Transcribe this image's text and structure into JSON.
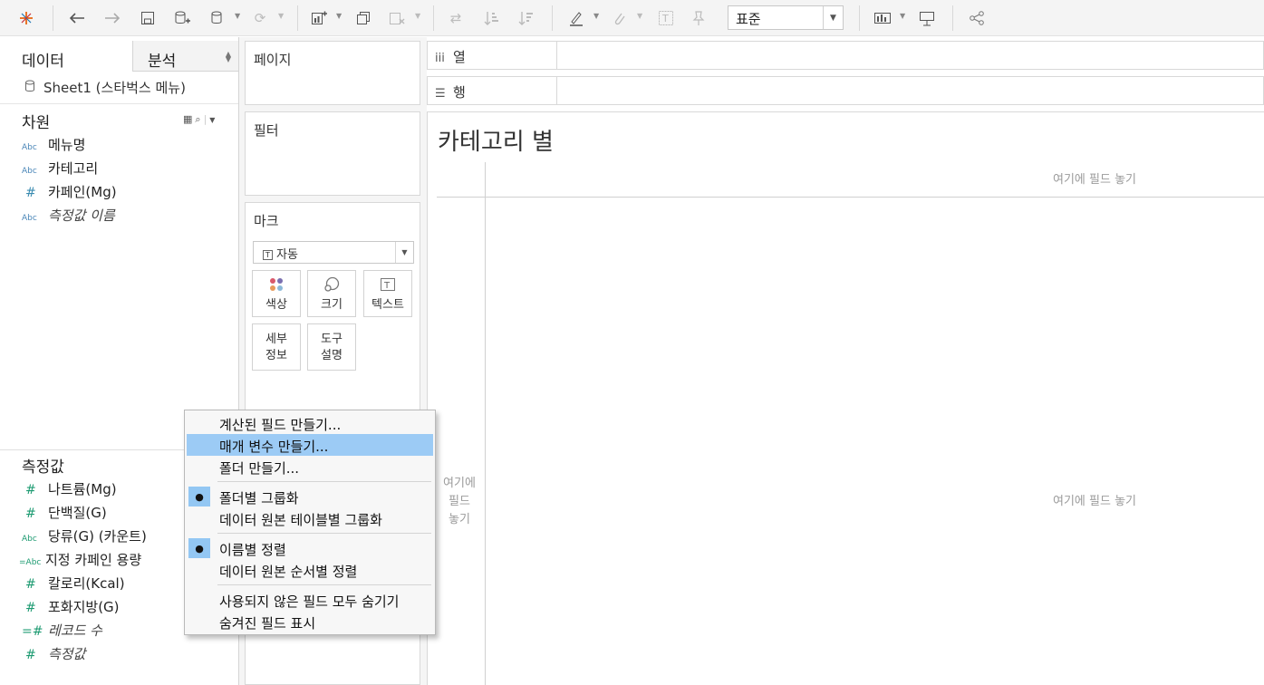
{
  "toolbar": {
    "fit_value": "표준"
  },
  "data_pane": {
    "tabs": [
      {
        "label": "데이터"
      },
      {
        "label": "분석"
      }
    ],
    "datasource": "Sheet1 (스타벅스 메뉴)",
    "dimensions_header": "차원",
    "dimensions": [
      {
        "icon": "Abc",
        "label": "메뉴명"
      },
      {
        "icon": "Abc",
        "label": "카테고리"
      },
      {
        "icon": "#",
        "label": "카페인(Mg)"
      },
      {
        "icon": "Abc",
        "label": "측정값 이름"
      }
    ],
    "measures_header": "측정값",
    "measures": [
      {
        "icon": "#",
        "label": "나트륨(Mg)"
      },
      {
        "icon": "#",
        "label": "단백질(G)"
      },
      {
        "icon": "Abc",
        "label": "당류(G) (카운트)"
      },
      {
        "icon": "=Abc",
        "label": "지정 카페인 용량"
      },
      {
        "icon": "#",
        "label": "칼로리(Kcal)"
      },
      {
        "icon": "#",
        "label": "포화지방(G)"
      },
      {
        "icon": "=#",
        "label": "레코드 수"
      },
      {
        "icon": "#",
        "label": "측정값"
      }
    ]
  },
  "cards": {
    "pages": "페이지",
    "filters": "필터",
    "marks": "마크",
    "mark_type": "자동",
    "mark_type_icon": "T",
    "mark_buttons": [
      {
        "label": "색상",
        "icon": "color-dots-icon"
      },
      {
        "label": "크기",
        "icon": "size-icon"
      },
      {
        "label": "텍스트",
        "icon": "text-icon"
      },
      {
        "label1": "세부",
        "label2": "정보"
      },
      {
        "label1": "도구",
        "label2": "설명"
      }
    ]
  },
  "shelves": {
    "columns_icon": "iii",
    "columns": "열",
    "rows_icon": "☰",
    "rows": "행"
  },
  "view": {
    "title": "카테고리 별",
    "drop_top": "여기에 필드 놓기",
    "drop_center": "여기에 필드 놓기",
    "drop_left_1": "여기에",
    "drop_left_2": "필드",
    "drop_left_3": "놓기"
  },
  "context_menu": {
    "items": [
      {
        "label": "계산된 필드 만들기...",
        "highlighted": false,
        "checked": false
      },
      {
        "label": "매개 변수 만들기...",
        "highlighted": true,
        "checked": false
      },
      {
        "label": "폴더 만들기...",
        "highlighted": false,
        "checked": false
      },
      {
        "label": "폴더별 그룹화",
        "highlighted": false,
        "checked": true
      },
      {
        "label": "데이터 원본 테이블별 그룹화",
        "highlighted": false,
        "checked": false
      },
      {
        "label": "이름별 정렬",
        "highlighted": false,
        "checked": true
      },
      {
        "label": "데이터 원본 순서별 정렬",
        "highlighted": false,
        "checked": false
      },
      {
        "label": "사용되지 않은 필드 모두 숨기기",
        "highlighted": false,
        "checked": false
      },
      {
        "label": "숨겨진 필드 표시",
        "highlighted": false,
        "checked": false
      }
    ],
    "check_glyph": "●"
  },
  "colors": {
    "highlight": "#9ccbf5",
    "dimension_icon": "#4a86b8",
    "measure_icon": "#1e9b72"
  }
}
